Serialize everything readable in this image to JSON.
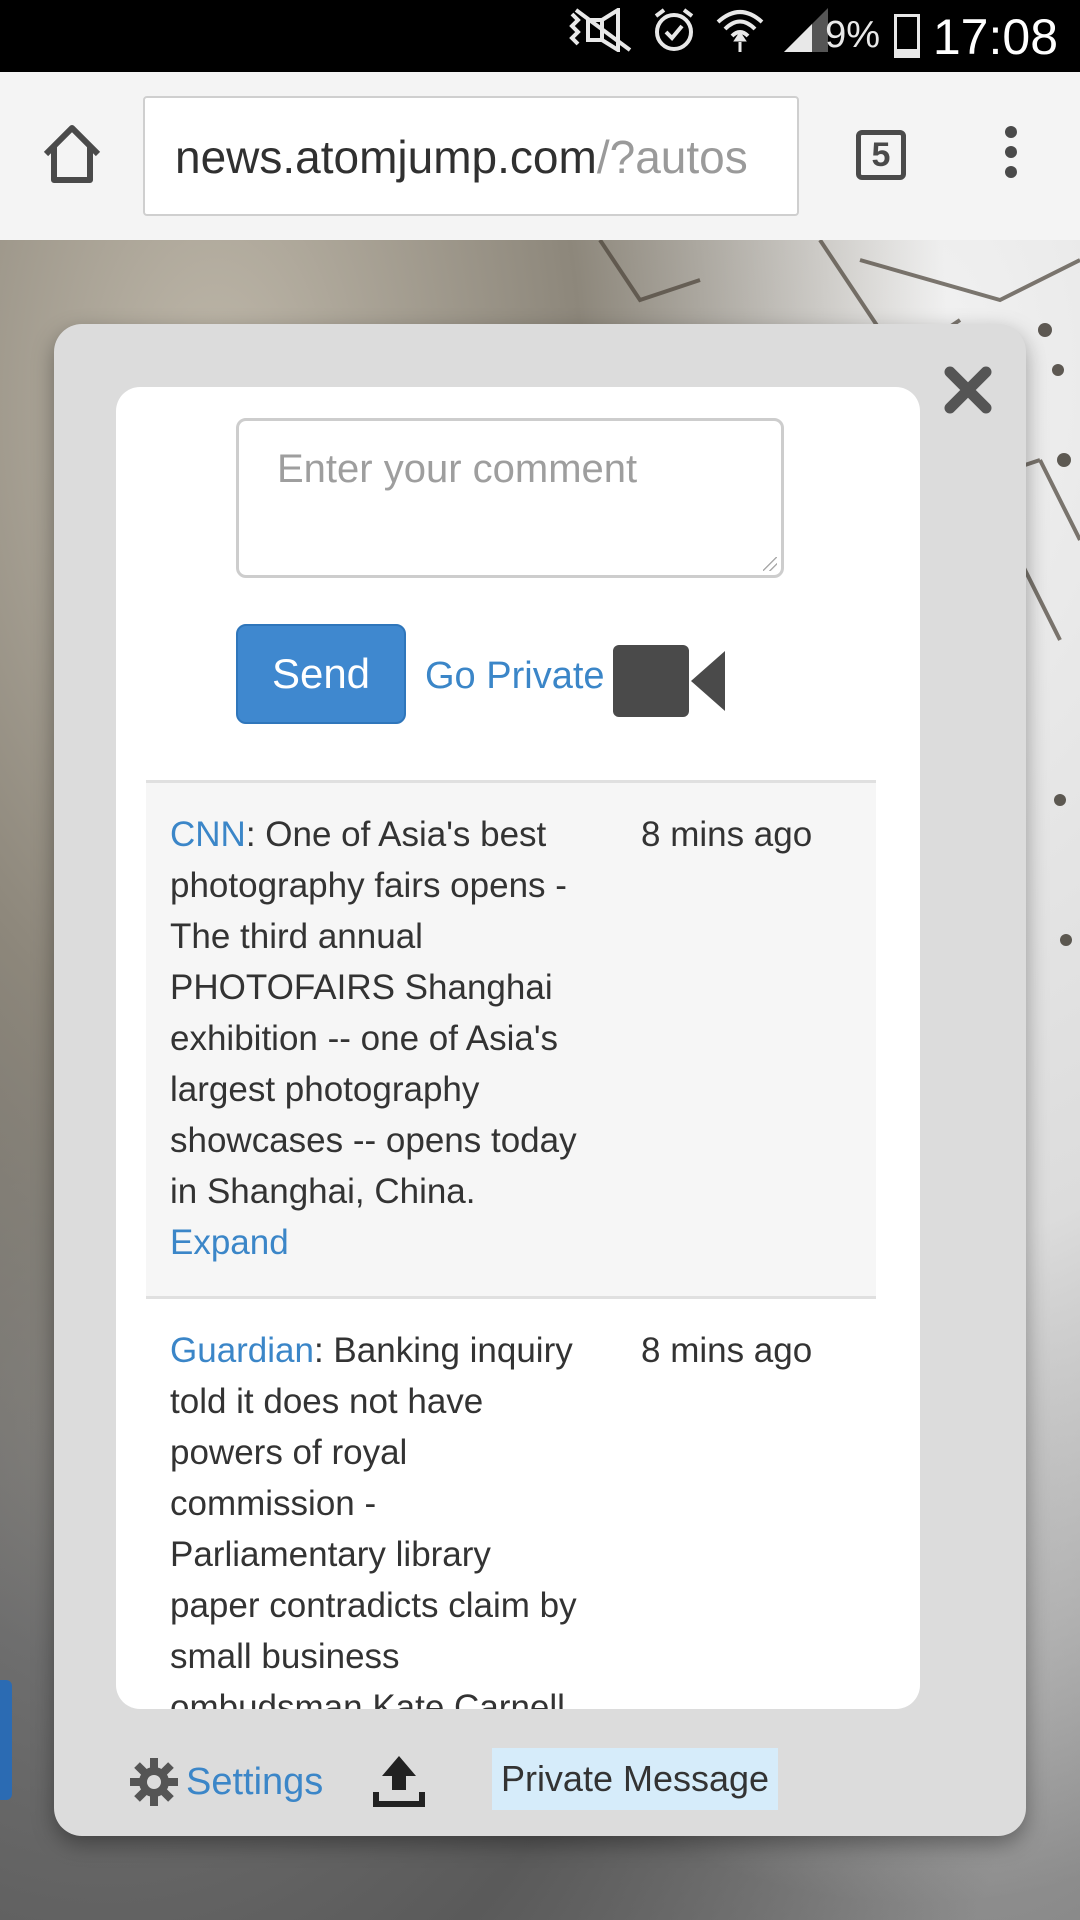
{
  "status_bar": {
    "battery_pct": "9%",
    "time": "17:08",
    "icons": [
      "mute-icon",
      "alarm-icon",
      "wifi-icon",
      "signal-icon",
      "battery-icon"
    ]
  },
  "browser": {
    "url_host": "news.atomjump.com",
    "url_path": "/?autos",
    "tab_count": "5"
  },
  "popup": {
    "comment_placeholder": "Enter your comment",
    "send_label": "Send",
    "go_private_label": "Go Private",
    "feed": [
      {
        "source": "CNN",
        "text": ": One of Asia's best photography fairs opens - The third annual PHOTOFAIRS Shanghai exhibition -- one of Asia's largest photography showcases -- opens today in Shanghai, China.",
        "expand": "Expand",
        "time": "8 mins ago"
      },
      {
        "source": "Guardian",
        "text": ": Banking inquiry told it does not have powers of royal commission - Parliamentary library paper contradicts claim by small business ombudsman Kate Carnell",
        "time": "8 mins ago"
      }
    ],
    "settings_label": "Settings",
    "private_message_label": "Private Message"
  },
  "colors": {
    "accent": "#3b86c8",
    "send_button": "#3f88cf",
    "private_message_bg": "#d6ecfa"
  }
}
